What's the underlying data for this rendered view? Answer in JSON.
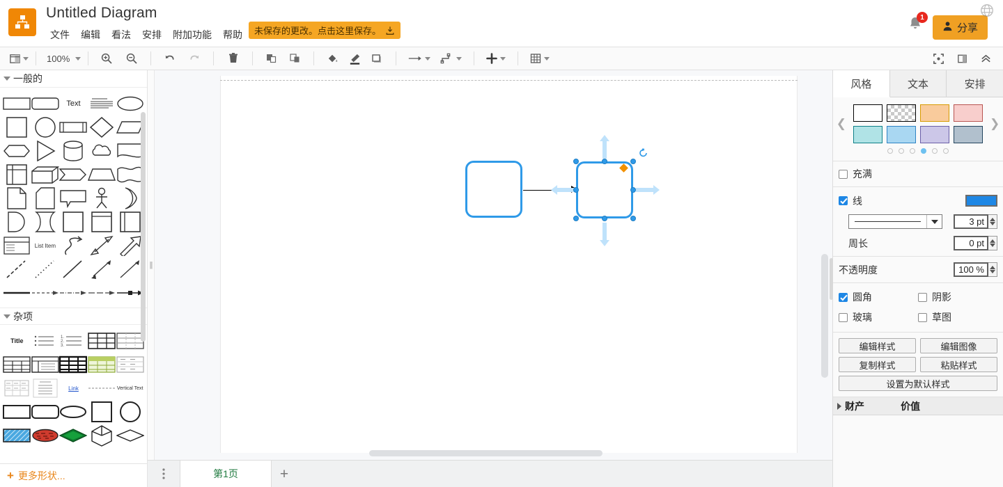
{
  "header": {
    "app_title": "Untitled Diagram",
    "logo_icon": "drawio-logo-icon",
    "menus": [
      "文件",
      "编辑",
      "看法",
      "安排",
      "附加功能",
      "帮助"
    ],
    "save_banner": {
      "text": "未保存的更改。点击这里保存。",
      "icon": "save-download-icon"
    },
    "notification": {
      "icon": "bell-icon",
      "count": "1"
    },
    "share": {
      "label": "分享",
      "icon": "user-icon"
    },
    "language_icon": "globe-icon",
    "colors": {
      "brand_orange": "#f08705",
      "share_orange": "#f0a023",
      "badge_red": "#e8281e"
    }
  },
  "toolbar": {
    "view_icon": "view-layout-icon",
    "zoom_label": "100%",
    "zoom_in_icon": "zoom-in-icon",
    "zoom_out_icon": "zoom-out-icon",
    "undo_icon": "undo-icon",
    "redo_icon": "redo-icon",
    "delete_icon": "trash-icon",
    "to_front_icon": "bring-to-front-icon",
    "to_back_icon": "send-to-back-icon",
    "fill_icon": "fill-color-icon",
    "line_icon": "line-color-icon",
    "shadow_icon": "shadow-icon",
    "connection_icon": "connection-arrow-icon",
    "waypoint_icon": "waypoint-icon",
    "insert_icon": "insert-plus-icon",
    "table_icon": "table-grid-icon",
    "fullscreen_icon": "fullscreen-icon",
    "format_panel_icon": "format-panel-icon",
    "collapse_icon": "collapse-chevron-icon"
  },
  "left_panel": {
    "sections": [
      {
        "title": "一般的",
        "shapes": [
          "rectangle",
          "rounded-rectangle",
          "text",
          "textbox",
          "ellipse",
          "square",
          "circle",
          "process",
          "diamond",
          "parallelogram",
          "hexagon",
          "triangle",
          "cylinder",
          "cloud",
          "document",
          "internal-storage",
          "cube",
          "step",
          "trapezoid",
          "tape",
          "note",
          "card",
          "callout",
          "actor",
          "or-shape",
          "delay",
          "data-storage",
          "container",
          "vertical-container",
          "vertical-lane",
          "list",
          "list-item",
          "curve",
          "bidirectional-arrow",
          "block-arrow",
          "dashed-line",
          "dotted-line",
          "plain-line",
          "double-arrow",
          "single-arrow",
          "thick-line",
          "dashed-arrow",
          "dash-dot-arrow",
          "long-dash-arrow",
          "box-arrow"
        ]
      },
      {
        "title": "杂项",
        "shapes": [
          "title-text",
          "unordered-list",
          "ordered-list",
          "table-grid",
          "table-rows",
          "table-header",
          "table-sidebar",
          "table-dark",
          "table-green",
          "table-light",
          "table-small",
          "table-form",
          "link",
          "dashed-divider",
          "vertical-text",
          "shape-rect",
          "shape-rounded",
          "shape-ellipse",
          "shape-square",
          "shape-circle",
          "hatched-rect",
          "scribble-ellipse",
          "green-rhombus",
          "isometric-cube",
          "thin-rhombus"
        ]
      }
    ],
    "more_shapes": {
      "label": "更多形状...",
      "icon": "plus-icon"
    },
    "splitter_icon": "splitter-grip-icon"
  },
  "canvas": {
    "nodes": [
      {
        "name": "shape-a",
        "selected": false
      },
      {
        "name": "shape-b",
        "selected": true
      }
    ],
    "edge": {
      "name": "connector-edge",
      "arrow": "left"
    },
    "selection": {
      "rotate_icon": "rotate-icon",
      "constraint_icon": "orange-diamond-handle",
      "direction_arrows": [
        "up",
        "right",
        "down",
        "left"
      ]
    },
    "shape_stroke_color": "#2f9ae8"
  },
  "right_panel": {
    "tabs": [
      {
        "label": "风格",
        "active": true
      },
      {
        "label": "文本",
        "active": false
      },
      {
        "label": "安排",
        "active": false
      }
    ],
    "presets": {
      "prev_icon": "chevron-left-icon",
      "next_icon": "chevron-right-icon",
      "swatches": [
        {
          "name": "white",
          "fill": "#ffffff",
          "stroke": "#000000"
        },
        {
          "name": "none-transparent",
          "fill": "transparent",
          "stroke": "#000000"
        },
        {
          "name": "orange",
          "fill": "#f9cb9c",
          "stroke": "#d79b00"
        },
        {
          "name": "red",
          "fill": "#f8cecc",
          "stroke": "#b85450"
        },
        {
          "name": "teal",
          "fill": "#b0e3e6",
          "stroke": "#0e8088"
        },
        {
          "name": "blue",
          "fill": "#a9d7f2",
          "stroke": "#2e83c4"
        },
        {
          "name": "purple",
          "fill": "#ccc7e8",
          "stroke": "#6a5fa8"
        },
        {
          "name": "gray-blue",
          "fill": "#b1c0cd",
          "stroke": "#23445d"
        }
      ],
      "page_dots": 6,
      "active_dot": 4
    },
    "fill": {
      "label": "充满",
      "checked": false
    },
    "line": {
      "label": "线",
      "checked": true,
      "color": "#1e87e5",
      "style_name": "solid-line",
      "width_value": "3 pt",
      "perimeter_label": "周长",
      "perimeter_value": "0 pt"
    },
    "opacity": {
      "label": "不透明度",
      "value": "100 %"
    },
    "options": [
      {
        "label": "圆角",
        "checked": true
      },
      {
        "label": "阴影",
        "checked": false
      },
      {
        "label": "玻璃",
        "checked": false
      },
      {
        "label": "草图",
        "checked": false
      }
    ],
    "buttons": [
      [
        "编辑样式",
        "编辑图像"
      ],
      [
        "复制样式",
        "粘贴样式"
      ]
    ],
    "default_style_button": "设置为默认样式",
    "properties_table": {
      "col1": "财产",
      "col2": "价值"
    }
  },
  "footer": {
    "page_menu_icon": "page-menu-icon",
    "pages": [
      {
        "label": "第1页",
        "active": true
      }
    ],
    "add_page_icon": "plus-icon"
  }
}
